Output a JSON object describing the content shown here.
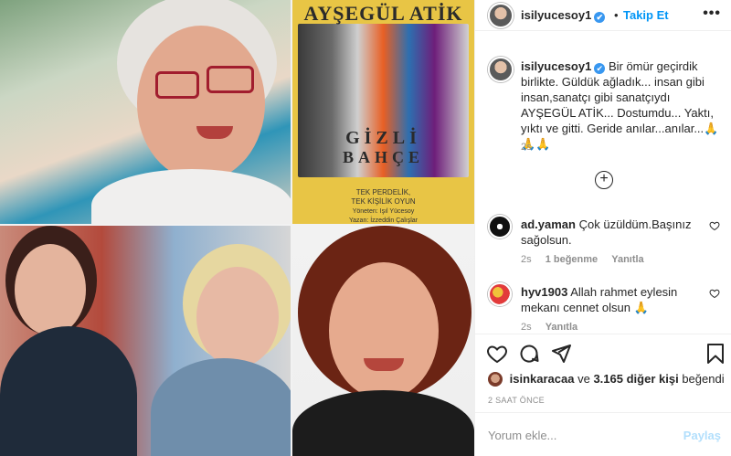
{
  "post": {
    "username": "isilyucesoy1",
    "verified_mark": "✔",
    "dot": "•",
    "follow_label": "Takip Et",
    "more_label": "•••"
  },
  "poster": {
    "title": "AYŞEGÜL ATİK",
    "big_line1": "GİZLİ",
    "big_line2": "BAHÇE",
    "small_line1": "TEK PERDELİK,",
    "small_line2": "TEK KİŞİLİK OYUN",
    "credit1": "Yöneten: Işıl Yücesoy",
    "credit2": "Yazan: İzzeddin Çalışlar"
  },
  "caption": {
    "username": "isilyucesoy1",
    "text": "Bir ömür geçirdik birlikte. Güldük ağladık... insan gibi insan,sanatçı gibi sanatçıydı AYŞEGÜL ATİK... Dostumdu... Yaktı, yıktı ve gitti. Geride anılar...anılar...🙏🙏🙏",
    "time": "2s"
  },
  "load_more": "+",
  "comments": [
    {
      "username": "ad.yaman",
      "text": "Çok üzüldüm.Başınız sağolsun.",
      "time": "2s",
      "likes": "1 beğenme",
      "reply": "Yanıtla"
    },
    {
      "username": "hyv1903",
      "text": "Allah rahmet eylesin mekanı cennet olsun 🙏",
      "time": "2s",
      "reply": "Yanıtla"
    }
  ],
  "likes": {
    "liker": "isinkaracaa",
    "connector": "ve",
    "others": "3.165 diğer kişi",
    "suffix": "beğendi"
  },
  "post_time": "2 SAAT ÖNCE",
  "add_comment": {
    "placeholder": "Yorum ekle...",
    "post_label": "Paylaş"
  },
  "colors": {
    "accent": "#0095f6",
    "verified": "#3897f0",
    "muted": "#8e8e8e",
    "disabled_post": "#b2dffc"
  }
}
